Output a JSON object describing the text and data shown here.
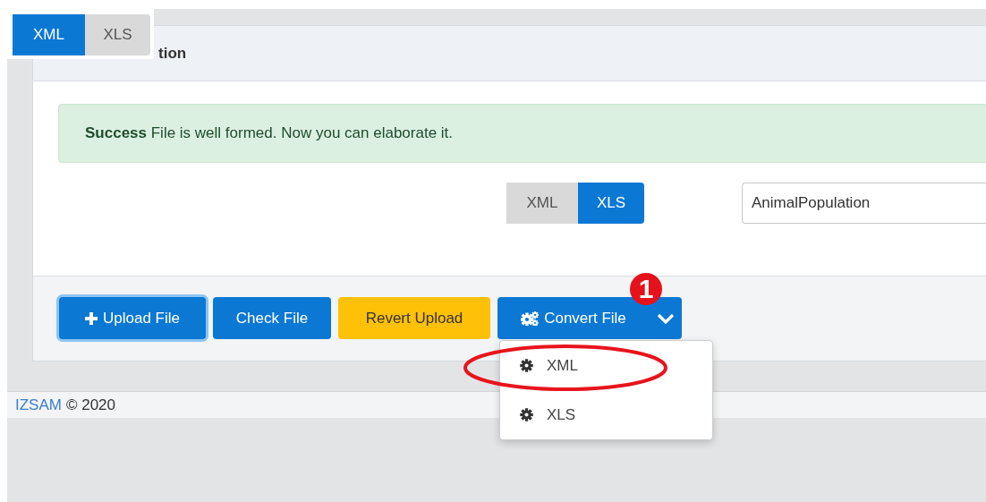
{
  "view_toggle": [
    {
      "label": "XML",
      "selected": true
    },
    {
      "label": "XLS",
      "selected": false
    }
  ],
  "panel": {
    "title": "tion",
    "alert": {
      "text": "**Success** File is well formed. Now you can elaborate it."
    },
    "format_toggle": [
      {
        "label": "XML",
        "selected": false
      },
      {
        "label": "XLS",
        "selected": true
      }
    ],
    "name_field": {
      "value": "AnimalPopulation"
    },
    "actions": [
      {
        "label": "Upload File",
        "kind": "add",
        "focused": true
      },
      {
        "label": "Check File",
        "kind": "primary",
        "focused": false
      },
      {
        "label": "Revert Upload",
        "kind": "warning",
        "focused": false
      },
      {
        "label": "Convert File",
        "kind": "split",
        "focused": false
      }
    ],
    "convert_menu": {
      "items": [
        {
          "label": "XML",
          "circled": true
        },
        {
          "label": "XLS",
          "circled": false
        }
      ]
    },
    "step_badge": "1"
  },
  "footer": {
    "link": "IZSAM",
    "text": "© 2020"
  }
}
